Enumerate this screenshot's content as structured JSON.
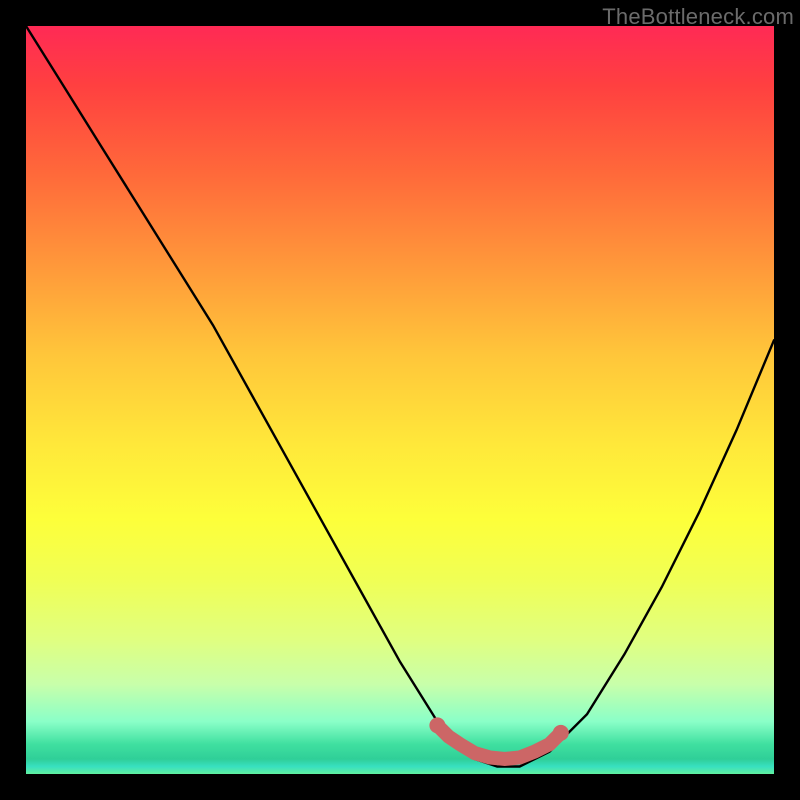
{
  "watermark": "TheBottleneck.com",
  "chart_data": {
    "type": "line",
    "title": "",
    "xlabel": "",
    "ylabel": "",
    "xlim": [
      0,
      100
    ],
    "ylim": [
      0,
      100
    ],
    "grid": false,
    "series": [
      {
        "name": "curve",
        "x": [
          0,
          5,
          10,
          15,
          20,
          25,
          30,
          35,
          40,
          45,
          50,
          55,
          57,
          60,
          63,
          66,
          70,
          75,
          80,
          85,
          90,
          95,
          100
        ],
        "y": [
          100,
          92,
          84,
          76,
          68,
          60,
          51,
          42,
          33,
          24,
          15,
          7,
          4,
          2,
          1,
          1,
          3,
          8,
          16,
          25,
          35,
          46,
          58
        ]
      }
    ],
    "markers": {
      "name": "flat-region",
      "x": [
        55,
        56.5,
        58,
        60,
        62,
        64,
        66,
        68,
        70,
        71.5
      ],
      "y": [
        6.5,
        5,
        4,
        2.8,
        2.2,
        2,
        2.2,
        3,
        4,
        5.5
      ]
    },
    "background_gradient": {
      "top": "#ff2a55",
      "mid": "#ffe83a",
      "bottom": "#38e0c0"
    }
  }
}
